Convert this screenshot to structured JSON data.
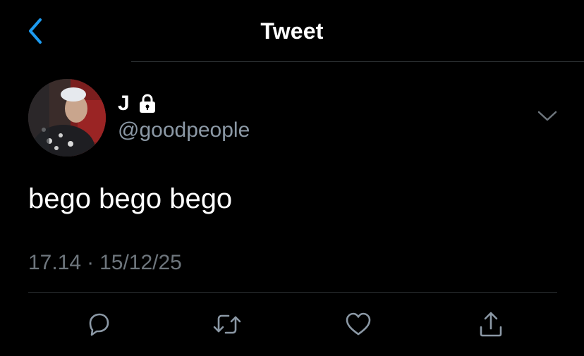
{
  "header": {
    "title": "Tweet",
    "back_icon": "chevron-left-icon"
  },
  "colors": {
    "background": "#000000",
    "accent": "#1d9bf0",
    "secondary_text": "#8b98a5",
    "divider": "#2f3336",
    "icon": "#8b98a5"
  },
  "tweet": {
    "display_name": "J",
    "protected_icon": "lock-icon",
    "handle": "@goodpeople",
    "text": "bego bego bego",
    "time": "17.14",
    "separator": "·",
    "date": "15/12/25",
    "more_icon": "chevron-down-icon"
  },
  "actions": [
    {
      "name": "reply",
      "icon": "reply-icon"
    },
    {
      "name": "retweet",
      "icon": "retweet-icon"
    },
    {
      "name": "like",
      "icon": "heart-icon"
    },
    {
      "name": "share",
      "icon": "share-icon"
    }
  ]
}
